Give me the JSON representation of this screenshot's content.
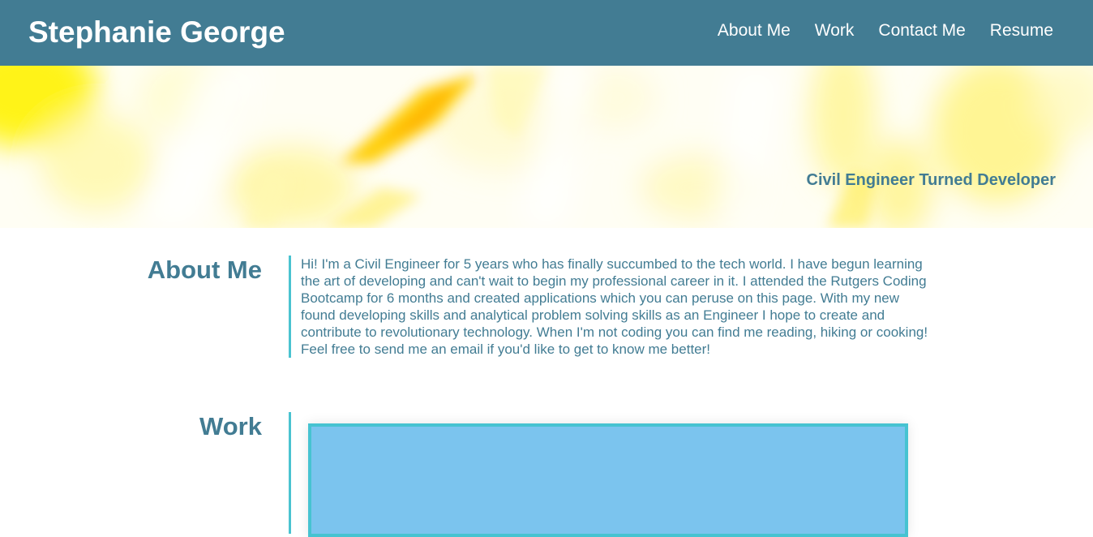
{
  "header": {
    "title": "Stephanie George",
    "nav": [
      {
        "label": "About Me"
      },
      {
        "label": "Work"
      },
      {
        "label": "Contact Me"
      },
      {
        "label": "Resume"
      }
    ]
  },
  "hero": {
    "tagline": "Civil Engineer Turned Developer"
  },
  "about": {
    "heading": "About Me",
    "text": "Hi! I'm a Civil Engineer for 5 years who has finally succumbed to the tech world. I have begun learning the art of developing and can't wait to begin my professional career in it. I attended the Rutgers Coding Bootcamp for 6 months and created applications which you can peruse on this page. With my new found developing skills and analytical problem solving skills as an Engineer I hope to create and contribute to revolutionary technology. When I'm not coding you can find me reading, hiking or cooking! Feel free to send me an email if you'd like to get to know me better!"
  },
  "work": {
    "heading": "Work"
  },
  "colors": {
    "header_bg": "#427c93",
    "accent": "#4ac3d0",
    "text": "#427c93",
    "work_tile": "#7bc4ee"
  }
}
